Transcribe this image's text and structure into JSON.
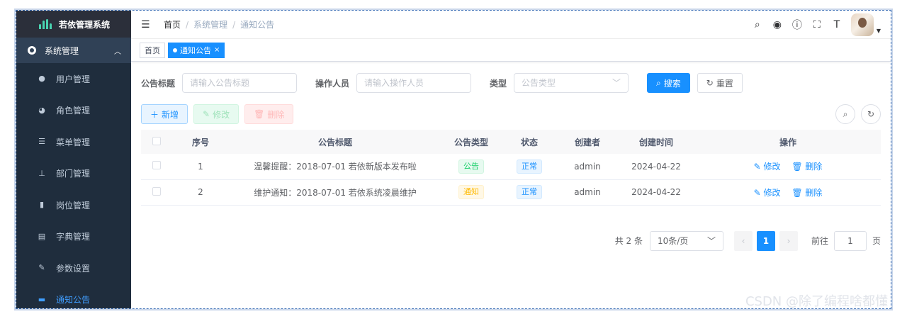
{
  "app": {
    "title": "若依管理系统"
  },
  "sidebar": {
    "group": {
      "label": "系统管理",
      "icon": "gear-icon"
    },
    "items": [
      {
        "label": "用户管理",
        "icon": "user-icon",
        "active": false
      },
      {
        "label": "角色管理",
        "icon": "peoples-icon",
        "active": false
      },
      {
        "label": "菜单管理",
        "icon": "tree-table-icon",
        "active": false
      },
      {
        "label": "部门管理",
        "icon": "tree-icon",
        "active": false
      },
      {
        "label": "岗位管理",
        "icon": "post-icon",
        "active": false
      },
      {
        "label": "字典管理",
        "icon": "dict-icon",
        "active": false
      },
      {
        "label": "参数设置",
        "icon": "edit-icon",
        "active": false
      },
      {
        "label": "通知公告",
        "icon": "message-icon",
        "active": true
      }
    ]
  },
  "navbar": {
    "breadcrumb": [
      "首页",
      "系统管理",
      "通知公告"
    ],
    "icons": [
      "search-icon",
      "github-icon",
      "question-icon",
      "fullscreen-icon",
      "font-size-icon"
    ]
  },
  "tags": {
    "home": "首页",
    "current": "通知公告"
  },
  "search": {
    "title_label": "公告标题",
    "title_placeholder": "请输入公告标题",
    "operator_label": "操作人员",
    "operator_placeholder": "请输入操作人员",
    "type_label": "类型",
    "type_placeholder": "公告类型",
    "search_btn": "搜索",
    "reset_btn": "重置"
  },
  "toolbar": {
    "add": "新增",
    "edit": "修改",
    "delete": "删除"
  },
  "table": {
    "headers": [
      "序号",
      "公告标题",
      "公告类型",
      "状态",
      "创建者",
      "创建时间",
      "操作"
    ],
    "rows": [
      {
        "id": "1",
        "title": "温馨提醒：2018-07-01 若依新版本发布啦",
        "type": "公告",
        "status": "正常",
        "creator": "admin",
        "time": "2024-04-22"
      },
      {
        "id": "2",
        "title": "维护通知：2018-07-01 若依系统凌晨维护",
        "type": "通知",
        "status": "正常",
        "creator": "admin",
        "time": "2024-04-22"
      }
    ],
    "op_edit": "修改",
    "op_delete": "删除"
  },
  "pagination": {
    "total": "共 2 条",
    "page_size": "10条/页",
    "current_page": "1",
    "goto_label": "前往",
    "goto_value": "1",
    "page_unit": "页"
  },
  "watermark": "CSDN @除了编程啥都懂",
  "colors": {
    "primary": "#1890ff",
    "sidebar": "#304156",
    "submenu": "#1f2d3d"
  }
}
